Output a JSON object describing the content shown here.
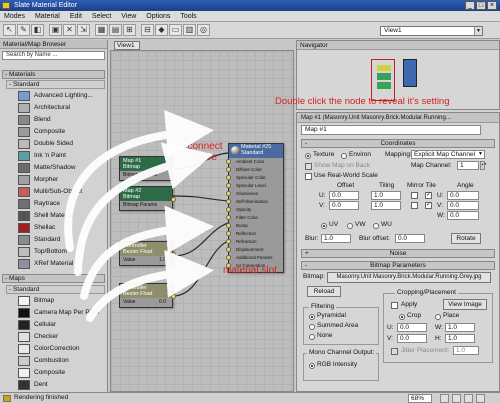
{
  "window": {
    "title": "Slate Material Editor",
    "min": "_",
    "max": "□",
    "close": "×"
  },
  "menu": [
    "Modes",
    "Material",
    "Edit",
    "Select",
    "View",
    "Options",
    "Tools"
  ],
  "toolbar": {
    "view_dropdown": "View1"
  },
  "browser": {
    "title": "Material/Map Browser",
    "search_placeholder": "Search by Name ...",
    "materials_group": "- Materials",
    "standard_sub": "- Standard",
    "materials": [
      {
        "label": "Advanced Lighting...",
        "swatch": "#7c9ad8"
      },
      {
        "label": "Architectural",
        "swatch": "#b0b0b0"
      },
      {
        "label": "Blend",
        "swatch": "#888888"
      },
      {
        "label": "Composite",
        "swatch": "#9a9a9a"
      },
      {
        "label": "Double Sided",
        "swatch": "#bbbbbb"
      },
      {
        "label": "Ink 'n Paint",
        "swatch": "#5aa0a0"
      },
      {
        "label": "Matte/Shadow",
        "swatch": "#6d6d6d"
      },
      {
        "label": "Morpher",
        "swatch": "#a0a0a0"
      },
      {
        "label": "Multi/Sub-Object",
        "swatch": "#c06060"
      },
      {
        "label": "Raytrace",
        "swatch": "#707070"
      },
      {
        "label": "Shell Material",
        "swatch": "#555555"
      },
      {
        "label": "Shellac",
        "swatch": "#a02020"
      },
      {
        "label": "Standard",
        "swatch": "#8c8c8c"
      },
      {
        "label": "Top/Bottom",
        "swatch": "#bdbdbd"
      },
      {
        "label": "XRef Material",
        "swatch": "#9090a0"
      }
    ],
    "maps_group": "- Maps",
    "maps": [
      {
        "label": "Bitmap",
        "swatch": "#f2f2f2"
      },
      {
        "label": "Camera Map Per Pixel",
        "swatch": "#111111"
      },
      {
        "label": "Cellular",
        "swatch": "#222222"
      },
      {
        "label": "Checker",
        "swatch": "#e0e0e0"
      },
      {
        "label": "ColorCorrection",
        "swatch": "#e8e8e8"
      },
      {
        "label": "Combustion",
        "swatch": "#cccccc"
      },
      {
        "label": "Composite",
        "swatch": "#f0f0f0"
      },
      {
        "label": "Dent",
        "swatch": "#333333"
      }
    ]
  },
  "view": {
    "tab": "View1",
    "nodes": {
      "material": {
        "title": "Material #25",
        "subtitle": "Standard",
        "slots": [
          "Ambient Color",
          "Diffuse Color",
          "Specular Color",
          "Specular Level",
          "Glossiness",
          "Self-Illumination",
          "Opacity",
          "Filter Color",
          "Bump",
          "Reflection",
          "Refraction",
          "Displacement",
          "Additional Params",
          "mr Connection"
        ]
      },
      "map1": {
        "title": "Map #1",
        "subtitle": "Bitmap",
        "row": "Bitmap Params"
      },
      "map2": {
        "title": "Map #2",
        "subtitle": "Bitmap",
        "row": "Bitmap Params"
      },
      "ctrl1": {
        "title": "Controller",
        "subtitle": "Bezier Float",
        "label": "Value",
        "value": "1.0"
      },
      "ctrl2": {
        "title": "Controller",
        "subtitle": "Bezier Float",
        "label": "Value",
        "value": "0.0"
      }
    },
    "annotations": {
      "connect": "connect\n/ wire",
      "slot": "material slot"
    }
  },
  "navigator": {
    "title": "Navigator",
    "annotation": "Double click the node to reveal it's setting"
  },
  "props": {
    "header": "Map #1 (Masonry.Unit Masonry.Brick.Modular.Running...",
    "map_name": "Map #1",
    "coords": {
      "title": "Coordinates",
      "texture": "Texture",
      "environ": "Environ",
      "mapping_label": "Mapping:",
      "mapping_value": "Explicit Map Channel",
      "show_map": "Show Map on Back",
      "map_channel_label": "Map Channel:",
      "map_channel_value": "1",
      "use_real": "Use Real-World Scale",
      "col_offset": "Offset",
      "col_tiling": "Tiling",
      "col_mirror": "Mirror Tile",
      "col_angle": "Angle",
      "u": "U:",
      "v": "V:",
      "w": "W:",
      "u_offset": "0.0",
      "v_offset": "0.0",
      "u_tiling": "1.0",
      "v_tiling": "1.0",
      "u_angle": "0.0",
      "v_angle": "0.0",
      "w_angle": "0.0",
      "uv": "UV",
      "vw": "VW",
      "wu": "WU",
      "blur_label": "Blur:",
      "blur_value": "1.0",
      "blur_offset_label": "Blur offset:",
      "blur_offset_value": "0.0",
      "rotate": "Rotate"
    },
    "noise": {
      "title": "Noise"
    },
    "bitmap": {
      "title": "Bitmap Parameters",
      "bitmap_label": "Bitmap:",
      "bitmap_value": "Masonry.Unit Masonry.Brick.Modular.Running.Grey.jpg",
      "reload": "Reload",
      "cropping": "Cropping/Placement",
      "apply": "Apply",
      "view_image": "View Image",
      "crop": "Crop",
      "place": "Place",
      "u": "U:",
      "w": "W:",
      "v": "V:",
      "h": "H:",
      "u_val": "0.0",
      "w_val": "1.0",
      "v_val": "0.0",
      "h_val": "1.0",
      "jitter": "Jitter Placement:",
      "jitter_val": "1.0",
      "filtering": "Filtering",
      "pyramidal": "Pyramidal",
      "summed": "Summed Area",
      "none": "None",
      "mono": "Mono Channel Output:",
      "rgb": "RGB Intensity"
    }
  },
  "status": {
    "text": "Rendering finished",
    "zoom": "68%"
  }
}
